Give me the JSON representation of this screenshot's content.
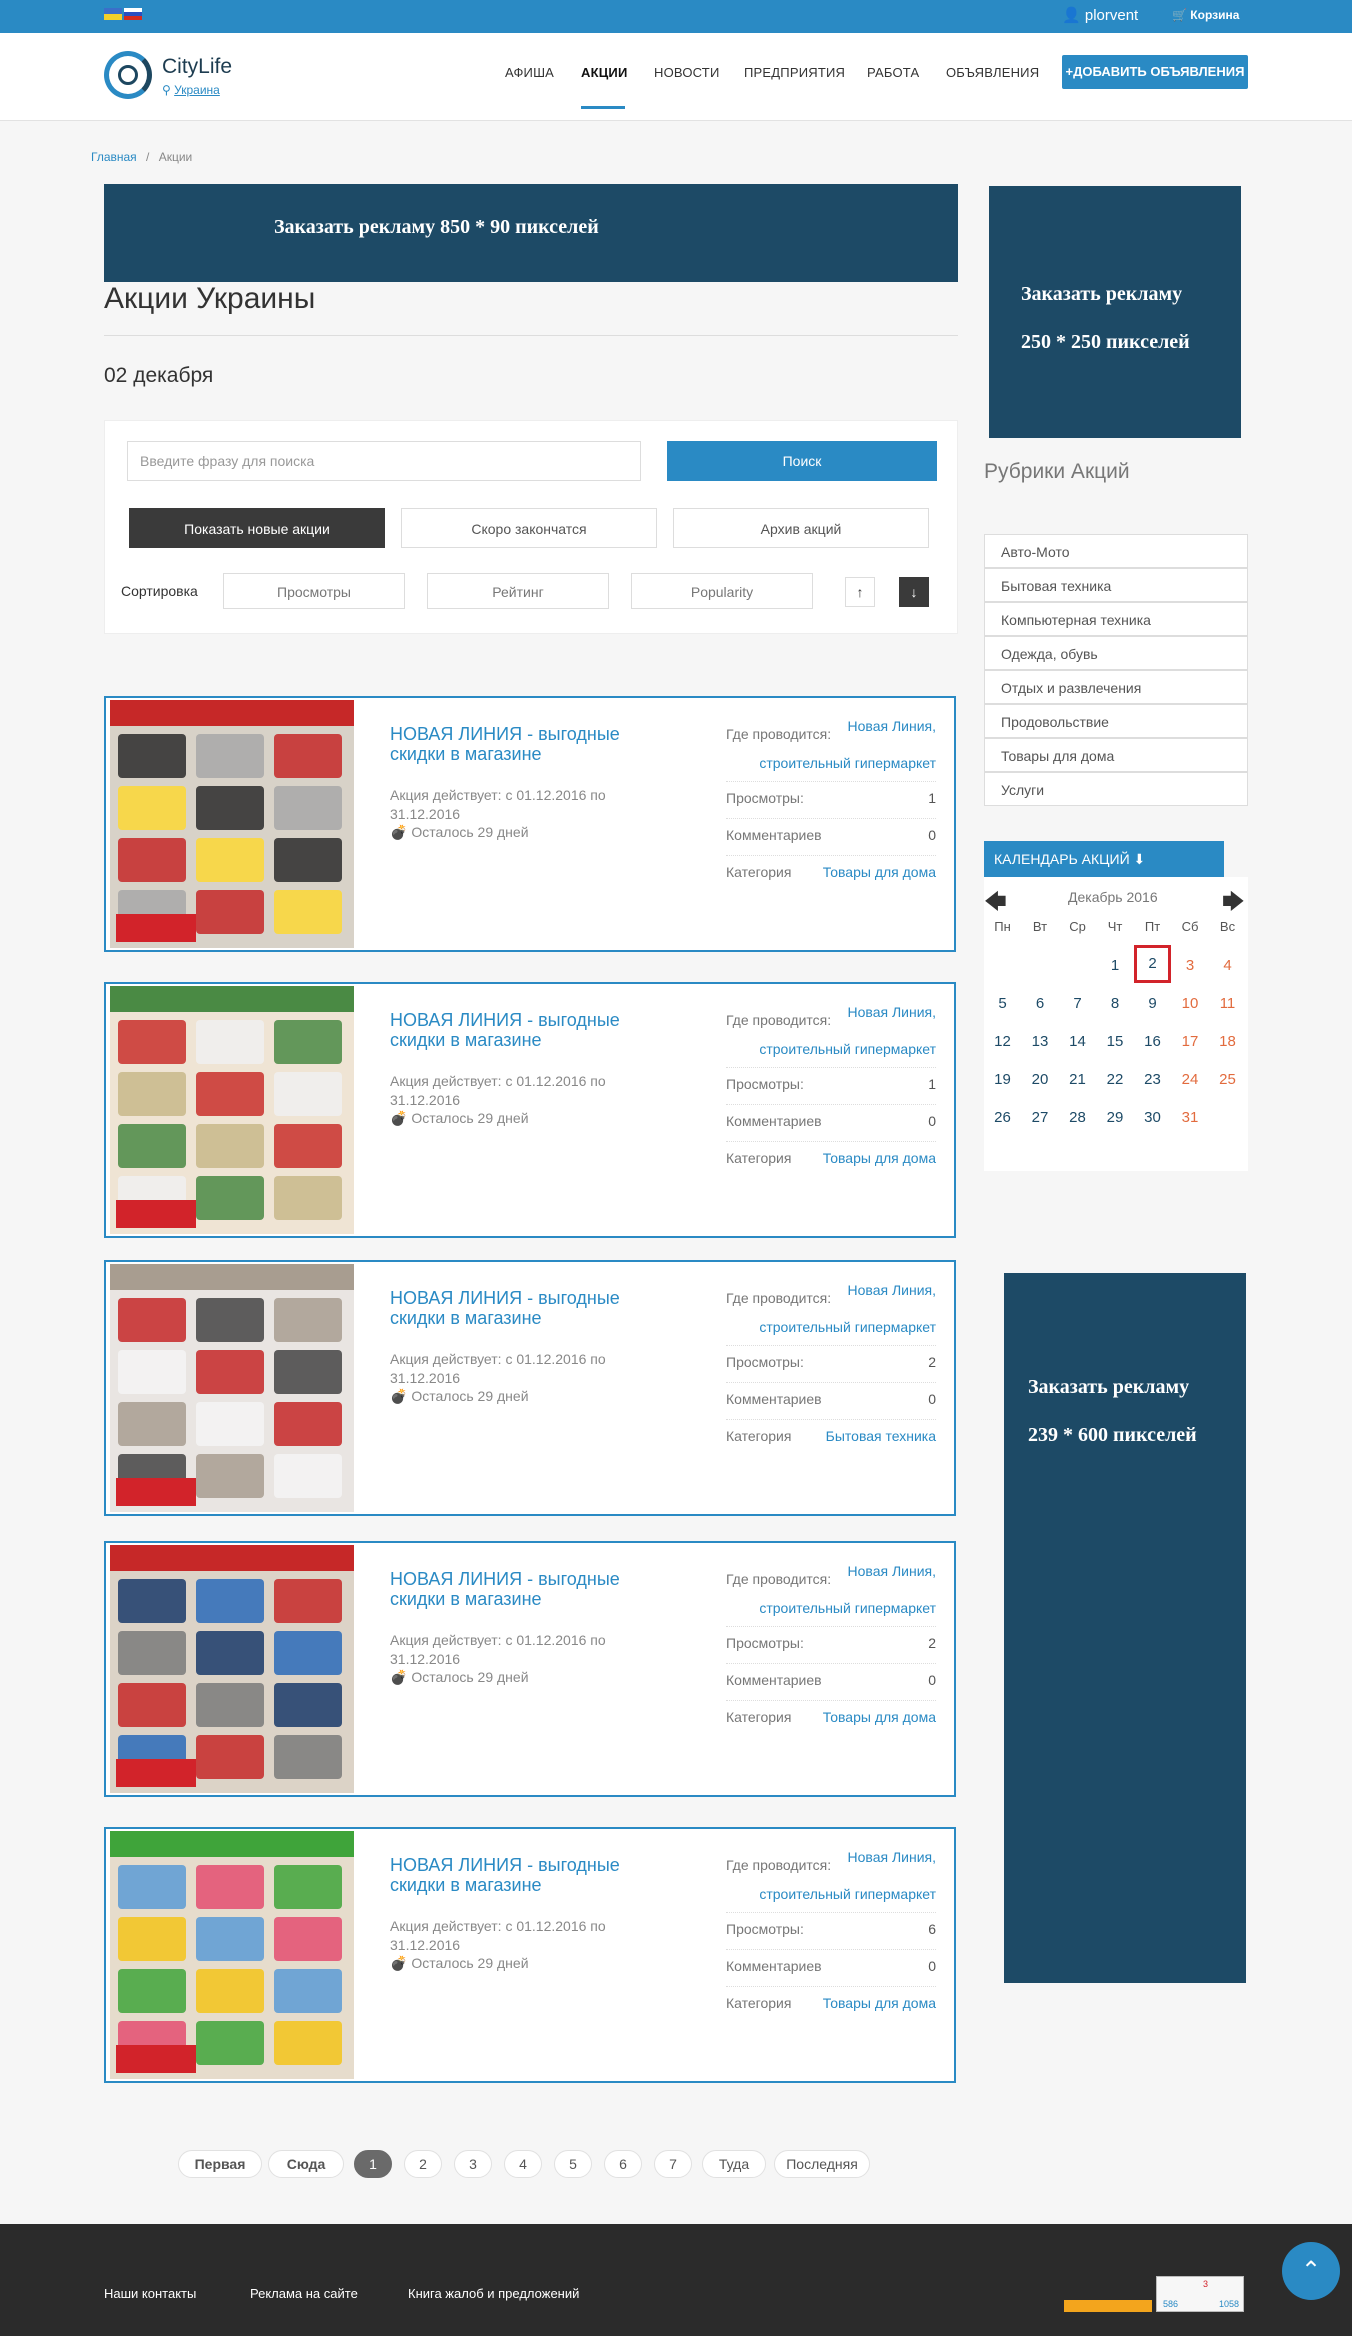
{
  "topbar": {
    "user": "plorvent",
    "cart": "Корзина"
  },
  "header": {
    "logo": {
      "name": "CityLife",
      "region": "Украина"
    },
    "nav": [
      "АФИША",
      "АКЦИИ",
      "НОВОСТИ",
      "ПРЕДПРИЯТИЯ",
      "РАБОТА",
      "ОБЪЯВЛЕНИЯ"
    ],
    "active_nav": "АКЦИИ",
    "add_button": "ДОБАВИТЬ ОБЪЯВЛЕНИЯ"
  },
  "breadcrumb": {
    "home": "Главная",
    "separator": "/",
    "current": "Акции"
  },
  "banner_top": "Заказать рекламу  850 * 90 пикселей",
  "page_title": "Акции Украины",
  "date_heading": "02 декабря",
  "filters": {
    "search_placeholder": "Введите фразу для поиска",
    "search_button": "Поиск",
    "tabs": [
      "Показать новые акции",
      "Скоро закончатся",
      "Архив акций"
    ],
    "sort_label": "Сортировка",
    "sort_options": [
      "Просмотры",
      "Рейтинг",
      "Popularity"
    ],
    "sort_up": "↑",
    "sort_down": "↓"
  },
  "promo_labels": {
    "where": "Где проводится:",
    "views": "Просмотры:",
    "comments": "Комментариев",
    "category": "Категория"
  },
  "promos": [
    {
      "title": "НОВАЯ ЛИНИЯ - выгодные скидки в магазине",
      "period": "Акция действует: с 01.12.2016 по 31.12.2016",
      "remaining": "Осталось 29 дней",
      "store_name": "Новая Линия,",
      "store_type": "строительный гипермаркет",
      "views": "1",
      "comments": "0",
      "category": "Товары для дома"
    },
    {
      "title": "НОВАЯ ЛИНИЯ - выгодные скидки в магазине",
      "period": "Акция действует: с 01.12.2016 по 31.12.2016",
      "remaining": "Осталось 29 дней",
      "store_name": "Новая Линия,",
      "store_type": "строительный гипермаркет",
      "views": "1",
      "comments": "0",
      "category": "Товары для дома"
    },
    {
      "title": "НОВАЯ ЛИНИЯ - выгодные скидки в магазине",
      "period": "Акция действует: с 01.12.2016 по 31.12.2016",
      "remaining": "Осталось 29 дней",
      "store_name": "Новая Линия,",
      "store_type": "строительный гипермаркет",
      "views": "2",
      "comments": "0",
      "category": "Бытовая техника"
    },
    {
      "title": "НОВАЯ ЛИНИЯ - выгодные скидки в магазине",
      "period": "Акция действует: с 01.12.2016 по 31.12.2016",
      "remaining": "Осталось 29 дней",
      "store_name": "Новая Линия,",
      "store_type": "строительный гипермаркет",
      "views": "2",
      "comments": "0",
      "category": "Товары для дома"
    },
    {
      "title": "НОВАЯ ЛИНИЯ - выгодные скидки в магазине",
      "period": "Акция действует: с 01.12.2016 по 31.12.2016",
      "remaining": "Осталось 29 дней",
      "store_name": "Новая Линия,",
      "store_type": "строительный гипермаркет",
      "views": "6",
      "comments": "0",
      "category": "Товары для дома"
    }
  ],
  "pagination": [
    "Первая",
    "Сюда",
    "1",
    "2",
    "3",
    "4",
    "5",
    "6",
    "7",
    "Туда",
    "Последняя"
  ],
  "pagination_active": "1",
  "sidebar": {
    "ad1_line1": "Заказать рекламу",
    "ad1_line2": "250 * 250 пикселей",
    "rubrics_title": "Рубрики Акций",
    "rubrics": [
      "Авто-Мото",
      "Бытовая техника",
      "Компьютерная техника",
      "Одежда, обувь",
      "Отдых и развлечения",
      "Продовольствие",
      "Товары для дома",
      "Услуги"
    ],
    "calendar_button": "КАЛЕНДАРЬ АКЦИЙ ⬇",
    "calendar_month": "Декабрь 2016",
    "weekdays": [
      "Пн",
      "Вт",
      "Ср",
      "Чт",
      "Пт",
      "Сб",
      "Вс"
    ],
    "calendar_today": "2",
    "ad2_line1": "Заказать рекламу",
    "ad2_line2": "239 * 600 пикселей"
  },
  "footer": {
    "links": [
      "Наши контакты",
      "Реклама на сайте",
      "Книга жалоб и предложений"
    ],
    "counter_small": "586",
    "counter_big": "1058",
    "counter_top": "3"
  },
  "colors": {
    "accent": "#2a8ac4",
    "ad_blue": "#1d4a66",
    "weekend": "#e26b3e",
    "today": "#d2232a"
  }
}
